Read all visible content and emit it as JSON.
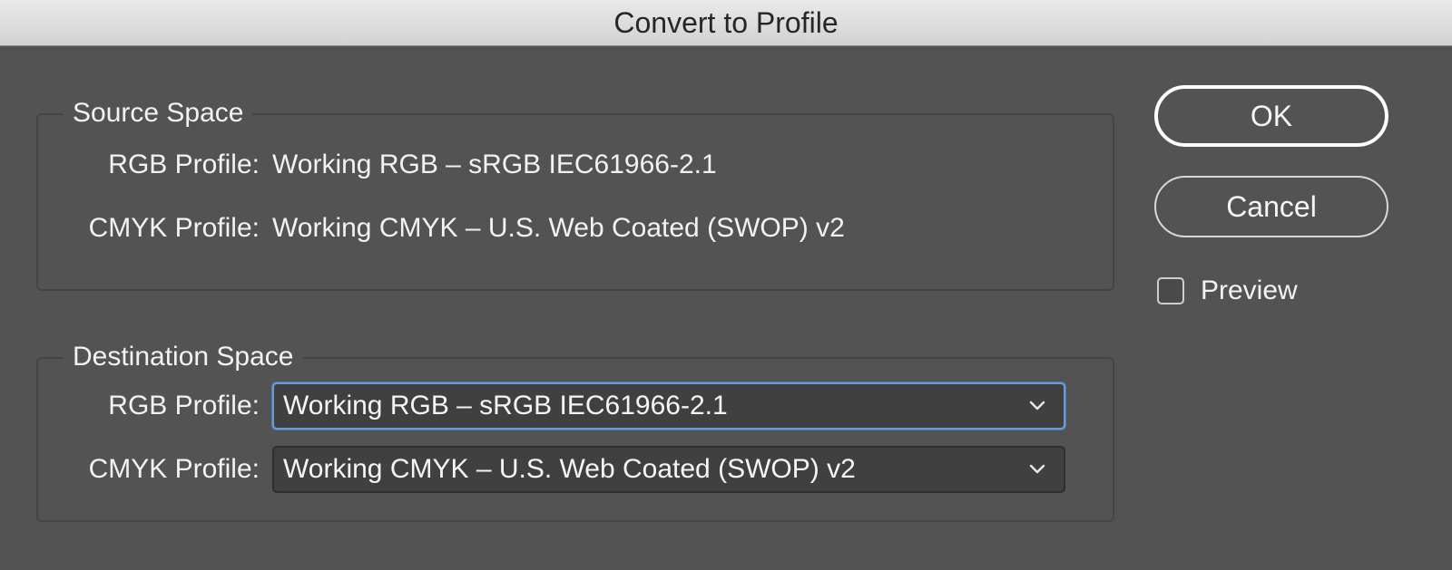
{
  "window": {
    "title": "Convert to Profile"
  },
  "source_space": {
    "legend": "Source Space",
    "rgb_label": "RGB Profile:",
    "rgb_value": "Working RGB – sRGB IEC61966-2.1",
    "cmyk_label": "CMYK Profile:",
    "cmyk_value": "Working CMYK – U.S. Web Coated (SWOP) v2"
  },
  "destination_space": {
    "legend": "Destination Space",
    "rgb_label": "RGB Profile:",
    "rgb_selected": "Working RGB – sRGB IEC61966-2.1",
    "cmyk_label": "CMYK Profile:",
    "cmyk_selected": "Working CMYK – U.S. Web Coated (SWOP) v2"
  },
  "buttons": {
    "ok": "OK",
    "cancel": "Cancel"
  },
  "preview": {
    "label": "Preview",
    "checked": false
  },
  "icons": {
    "dropdown": "chevron-down-icon"
  },
  "colors": {
    "background": "#535353",
    "focus_ring": "#6f9bd1"
  }
}
